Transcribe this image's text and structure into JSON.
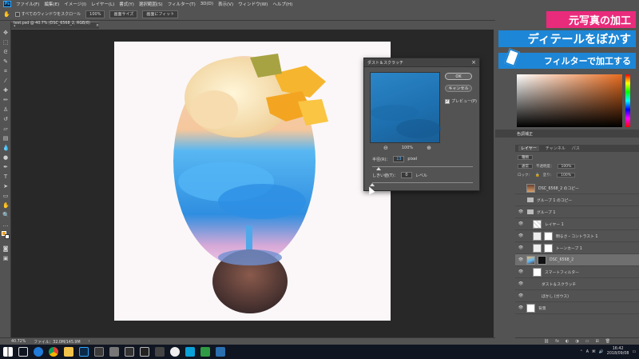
{
  "menubar": {
    "items": [
      "ファイル(F)",
      "編集(E)",
      "イメージ(I)",
      "レイヤー(L)",
      "書式(Y)",
      "選択範囲(S)",
      "フィルター(T)",
      "3D(D)",
      "表示(V)",
      "ウィンドウ(W)",
      "ヘルプ(H)"
    ]
  },
  "options": {
    "scroll_all_label": "すべてのウィンドウをスクロール",
    "zoom_value": "100%",
    "fit_screen_label": "画面サイズ",
    "fill_screen_label": "画面にフィット"
  },
  "document": {
    "tab_title": "test.psd @ 40.7% (DSC_6568_2, RGB/8) *",
    "tab_close": "×"
  },
  "status": {
    "zoom": "40.72%",
    "file_info": "ファイル：32.0M/145.9M",
    "arrow": "›"
  },
  "dialog": {
    "title": "ダスト＆スクラッチ",
    "close": "×",
    "ok_label": "OK",
    "cancel_label": "キャンセル",
    "preview_label": "プレビュー(P)",
    "preview_checked": "✓",
    "zoom_out": "⊖",
    "zoom_value": "100%",
    "zoom_in": "⊕",
    "radius_label": "半径(R)：",
    "radius_value": "13",
    "radius_unit": "pixel",
    "radius_fraction": 0.06,
    "threshold_label": "しきい値(T)：",
    "threshold_value": "0",
    "threshold_unit": "レベル",
    "threshold_fraction": 0.0
  },
  "banner": {
    "line1": "元写真の加工",
    "line2": "ディテールをぼかす",
    "line3": "フィルターで加工する",
    "line1_color": "#e92b7c",
    "line2_color": "#1d86d6"
  },
  "panels": {
    "top_tabs": [
      "色調補正"
    ],
    "layer_tabs": [
      "レイヤー",
      "チャンネル",
      "パス"
    ],
    "filter_kind": "種類",
    "blend_mode": "通常",
    "opacity_label": "不透明度：",
    "opacity_value": "100%",
    "lock_label": "ロック：",
    "fill_label": "塗り：",
    "fill_value": "100%"
  },
  "layers": [
    {
      "name": "DSC_6568_2 のコピー",
      "thumb": "photo",
      "visible": false,
      "indent": 0,
      "kind": "layer"
    },
    {
      "name": "グループ 1 のコピー",
      "thumb": "folder",
      "visible": false,
      "indent": 0,
      "kind": "group"
    },
    {
      "name": "グループ 1",
      "thumb": "folder",
      "visible": true,
      "indent": 0,
      "kind": "group"
    },
    {
      "name": "レイヤー 1",
      "thumb": "check",
      "visible": true,
      "indent": 1,
      "kind": "layer"
    },
    {
      "name": "明るさ・コントラスト 1",
      "thumb": "adj",
      "visible": true,
      "indent": 1,
      "kind": "adjustment"
    },
    {
      "name": "トーンカーブ 1",
      "thumb": "adj",
      "visible": true,
      "indent": 1,
      "kind": "adjustment"
    },
    {
      "name": "DSC_6568_2",
      "thumb": "img",
      "visible": true,
      "indent": 0,
      "kind": "smart",
      "selected": true
    },
    {
      "name": "スマートフィルター",
      "thumb": "white",
      "visible": true,
      "indent": 1,
      "kind": "filtermask"
    },
    {
      "name": "ダスト＆スクラッチ",
      "thumb": "",
      "visible": true,
      "indent": 2,
      "kind": "filter"
    },
    {
      "name": "ぼかし (ガウス)",
      "thumb": "",
      "visible": true,
      "indent": 2,
      "kind": "filter"
    },
    {
      "name": "背景",
      "thumb": "white",
      "visible": true,
      "indent": 0,
      "kind": "background"
    }
  ],
  "taskbar": {
    "ime": "A",
    "time": "16:42",
    "date": "2018/09/08"
  },
  "colors": {
    "ui_bg": "#535353",
    "workspace": "#282828",
    "taskbar": "#101522"
  }
}
